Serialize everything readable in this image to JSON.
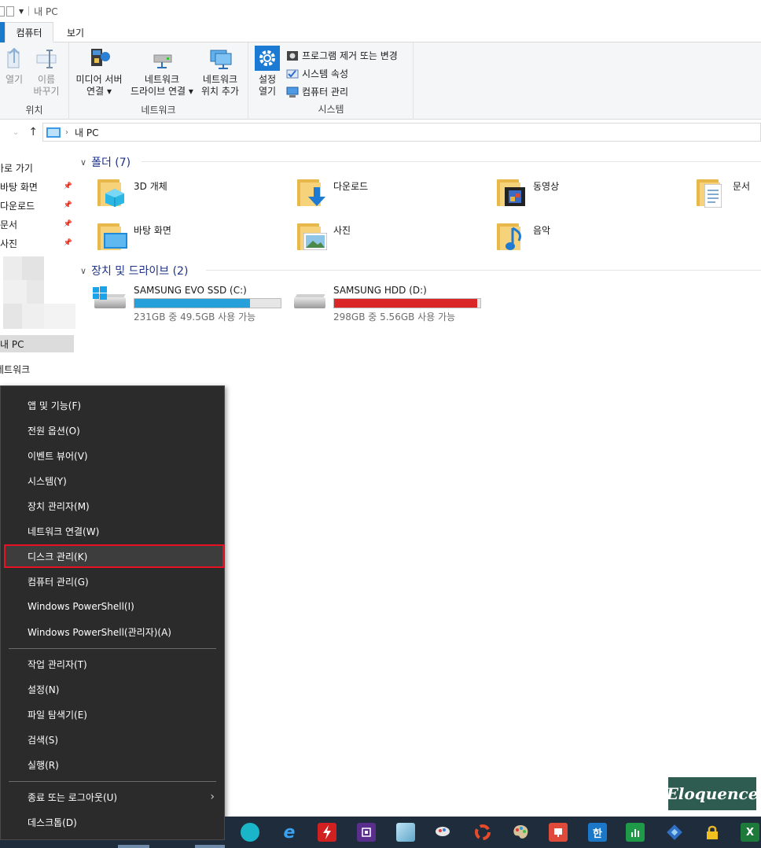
{
  "window": {
    "title": "내 PC"
  },
  "tabs": {
    "computer": "컴퓨터",
    "view": "보기"
  },
  "ribbon": {
    "location": {
      "open": "열기",
      "rename_l1": "이름",
      "rename_l2": "바꾸기",
      "label": "위치"
    },
    "network": {
      "media_l1": "미디어 서버",
      "media_l2": "연결",
      "drive_l1": "네트워크",
      "drive_l2": "드라이브 연결",
      "loc_l1": "네트워크",
      "loc_l2": "위치 추가",
      "label": "네트워크"
    },
    "system": {
      "settings_l1": "설정",
      "settings_l2": "열기",
      "uninstall": "프로그램 제거 또는 변경",
      "properties": "시스템 속성",
      "manage": "컴퓨터 관리",
      "label": "시스템"
    }
  },
  "address": {
    "path": "내 PC"
  },
  "navpane": {
    "quick_access": "바로 가기",
    "items": [
      "바탕 화면",
      "다운로드",
      "문서",
      "사진"
    ],
    "this_pc": "내 PC",
    "network": "네트워크"
  },
  "folders_section": {
    "title": "폴더 (7)"
  },
  "folders": [
    "3D 개체",
    "다운로드",
    "동영상",
    "문서",
    "바탕 화면",
    "사진",
    "음악"
  ],
  "drives_section": {
    "title": "장치 및 드라이브 (2)"
  },
  "drives": [
    {
      "name": "SAMSUNG EVO SSD (C:)",
      "size": "231GB 중 49.5GB 사용 가능",
      "used_fraction": 0.79,
      "bar_color": "#26a0da"
    },
    {
      "name": "SAMSUNG HDD (D:)",
      "size": "298GB 중 5.56GB 사용 가능",
      "used_fraction": 0.98,
      "bar_color": "#da2626"
    }
  ],
  "context_menu": {
    "items": [
      "앱 및 기능(F)",
      "전원 옵션(O)",
      "이벤트 뷰어(V)",
      "시스템(Y)",
      "장치 관리자(M)",
      "네트워크 연결(W)",
      "디스크 관리(K)",
      "컴퓨터 관리(G)",
      "Windows PowerShell(I)",
      "Windows PowerShell(관리자)(A)",
      "작업 관리자(T)",
      "설정(N)",
      "파일 탐색기(E)",
      "검색(S)",
      "실행(R)",
      "종료 또는 로그아웃(U)",
      "데스크톱(D)"
    ],
    "highlighted": "디스크 관리(K)"
  },
  "taskbar": {
    "icons": [
      "bird-app-icon",
      "internet-explorer-icon",
      "flash-icon",
      "processor-app-icon",
      "notes-icon",
      "paint-tool-icon",
      "media-app-icon",
      "palette-icon",
      "presentation-icon",
      "hangul-icon",
      "spreadsheet-icon",
      "network-icon",
      "lock-icon",
      "excel-icon"
    ],
    "glyphs": {
      "ie": "e",
      "hangul": "한",
      "excel": "X"
    }
  },
  "watermark": {
    "text": "Eloquence"
  },
  "colors": {
    "accent": "#1979ca",
    "menu_bg": "#2b2b2b",
    "highlight_border": "#e81123",
    "taskbar": "#1e2c3c"
  }
}
